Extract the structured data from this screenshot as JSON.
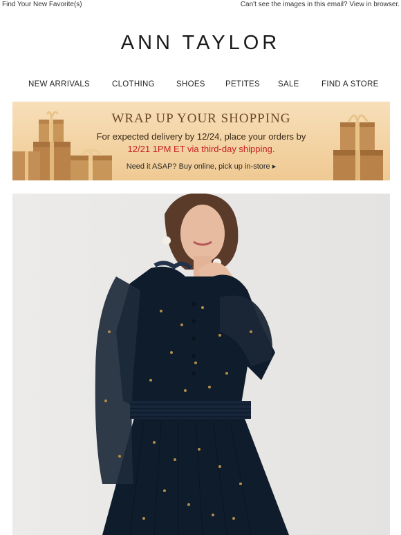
{
  "preheader": {
    "left": "Find Your New Favorite(s)",
    "right": "Can't see the images in this email? View in browser."
  },
  "brand": {
    "logo": "ANN TAYLOR"
  },
  "nav": [
    {
      "label": "NEW ARRIVALS"
    },
    {
      "label": "CLOTHING"
    },
    {
      "label": "SHOES"
    },
    {
      "label": "PETITES"
    },
    {
      "label": "SALE"
    },
    {
      "label": "FIND A STORE"
    }
  ],
  "banner": {
    "headline": "WRAP UP YOUR SHOPPING",
    "line1": "For expected delivery by 12/24, place your orders by",
    "line2": "12/21 1PM ET via third-day shipping.",
    "line3": "Need it ASAP? Buy online, pick up in-store ▸"
  },
  "colors": {
    "banner_bg": "#f3d3a3",
    "banner_headline": "#6a4a26",
    "deadline_red": "#c42020",
    "hero_bg": "#e9e8e6",
    "dress_navy": "#0f1c2b"
  }
}
